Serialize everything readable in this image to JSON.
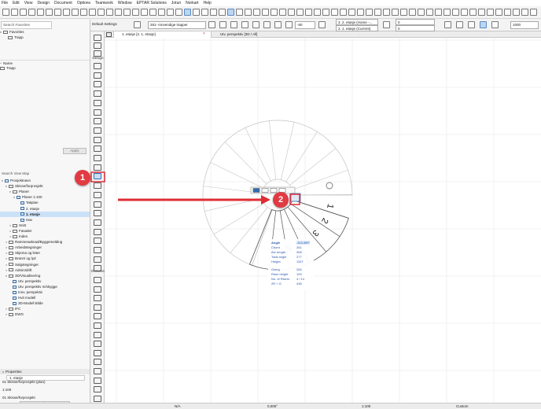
{
  "menu": [
    "File",
    "Edit",
    "View",
    "Design",
    "Document",
    "Options",
    "Teamwork",
    "Window",
    "EPTAR Solutions",
    "Jotun",
    "Norkart",
    "Help"
  ],
  "toolbar": {
    "default_settings": "Default Settings",
    "stair_type": "281- Innvendige trapper",
    "story_top": "3. 2. etasje (Home -...",
    "story_current": "2. 1. etasje (Current)",
    "offset_value": "-50",
    "value_a": "0",
    "value_b": "0",
    "value_c": "1000"
  },
  "leftpanel": {
    "search_placeholder": "Search Favorites",
    "favorites_title": "Favorites",
    "favorites_item": "Trapp",
    "name_header": "Name",
    "name_item": "Trapp",
    "apply_label": "Apply",
    "search_viewmap_placeholder": "Search View Map",
    "tree": [
      {
        "label": "Prosjektnavn",
        "indent": 0,
        "kind": "view",
        "caret": "v"
      },
      {
        "label": "Skisse/forprosjekt",
        "indent": 1,
        "kind": "folder",
        "caret": "v"
      },
      {
        "label": "Planer",
        "indent": 2,
        "kind": "folder",
        "caret": "v"
      },
      {
        "label": "Planer 1:100",
        "indent": 3,
        "kind": "view",
        "caret": "v"
      },
      {
        "label": "Takplan",
        "indent": 4,
        "kind": "view",
        "caret": ""
      },
      {
        "label": "2. etasje",
        "indent": 4,
        "kind": "view",
        "caret": ""
      },
      {
        "label": "1. etasje",
        "indent": 4,
        "kind": "view",
        "caret": "",
        "selected": true
      },
      {
        "label": "Hav",
        "indent": 4,
        "kind": "view",
        "caret": ""
      },
      {
        "label": "Snitt",
        "indent": 2,
        "kind": "folder",
        "caret": ">"
      },
      {
        "label": "Fasader",
        "indent": 2,
        "kind": "folder",
        "caret": ">"
      },
      {
        "label": "Indes",
        "indent": 2,
        "kind": "folder",
        "caret": ">"
      },
      {
        "label": "Rammesøknad/Byggemelding",
        "indent": 1,
        "kind": "folder",
        "caret": ">"
      },
      {
        "label": "Arbeidstegninger",
        "indent": 1,
        "kind": "folder",
        "caret": ">"
      },
      {
        "label": "Skjema og lister",
        "indent": 1,
        "kind": "folder",
        "caret": ">"
      },
      {
        "label": "Brann/ og lyd",
        "indent": 1,
        "kind": "folder",
        "caret": ">"
      },
      {
        "label": "Salgstegninger",
        "indent": 1,
        "kind": "folder",
        "caret": ">"
      },
      {
        "label": "Admin/drift",
        "indent": 1,
        "kind": "folder",
        "caret": ">"
      },
      {
        "label": "3D/Visualisering",
        "indent": 1,
        "kind": "folder",
        "caret": "v"
      },
      {
        "label": "Utv. perspektiv",
        "indent": 2,
        "kind": "view",
        "caret": ""
      },
      {
        "label": "Utv. perspektiv m/skygge",
        "indent": 2,
        "kind": "view",
        "caret": ""
      },
      {
        "label": "Innv. perspektiv",
        "indent": 2,
        "kind": "view",
        "caret": ""
      },
      {
        "label": "Hvit modell",
        "indent": 2,
        "kind": "view",
        "caret": ""
      },
      {
        "label": "3D-Modell Bilde",
        "indent": 2,
        "kind": "view",
        "caret": ""
      },
      {
        "label": "IFC",
        "indent": 1,
        "kind": "folder",
        "caret": ">"
      },
      {
        "label": "DWG",
        "indent": 1,
        "kind": "folder",
        "caret": ">"
      }
    ],
    "properties_title": "Properties",
    "prop_id": "1. etasje",
    "prop_scale": "1:100",
    "prop_layer": "01 Skisse/forprosjekt (plan)",
    "prop_layer2": "01 Skisse/forprosjekt",
    "settings_label": "Settings..."
  },
  "toolbox": {
    "design_header": "Design",
    "document_header": "Docume",
    "more_label": "More"
  },
  "tabs": {
    "plan": "1. etasje [2. 1. etasje]",
    "perspective": "Utv. perspektiv [3D / All]"
  },
  "stair_info": {
    "angle_label": "Angle",
    "angle_value": "-113,490°",
    "chord_label": "Chord",
    "chord_value": "261",
    "arc_label": "Arc length",
    "arc_value": "308",
    "total_label": "Total angle",
    "total_value": "277",
    "height_label": "Height",
    "height_value": "1157",
    "going_label": "Going",
    "going_value": "284",
    "riser_label": "Riser height",
    "riser_value": "193",
    "nr_label": "No. of Risers",
    "nr_value": "4 / 14",
    "formula_label": "2R + G",
    "formula_value": "436"
  },
  "step_numbers": [
    "1",
    "2",
    "3",
    "4",
    "5",
    "6"
  ],
  "callouts": [
    "1",
    "2"
  ],
  "statusbar": {
    "na": "N/A",
    "angle": "0,000°",
    "scale": "1:100",
    "view_option": "Custom"
  },
  "colors": {
    "callout_red": "#e13a43",
    "arrow_red": "#e02d35",
    "selection_blue": "#2f6db5",
    "info_blue": "#2a56b3"
  }
}
